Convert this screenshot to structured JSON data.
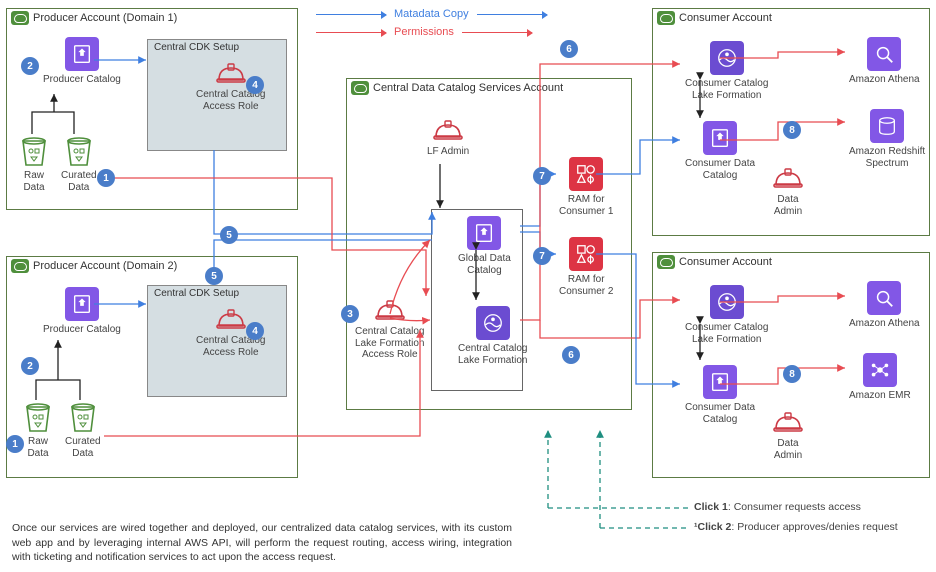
{
  "legend": {
    "metadata": "Matadata Copy",
    "permissions": "Permissions"
  },
  "producer1": {
    "title": "Producer Account (Domain 1)",
    "catalog": "Producer Catalog",
    "cdk_title": "Central CDK Setup",
    "access_role": "Central Catalog\nAccess Role",
    "raw": "Raw\nData",
    "curated": "Curated\nData"
  },
  "producer2": {
    "title": "Producer Account (Domain 2)",
    "catalog": "Producer Catalog",
    "cdk_title": "Central CDK Setup",
    "access_role": "Central Catalog\nAccess Role",
    "raw": "Raw\nData",
    "curated": "Curated\nData"
  },
  "central": {
    "title": "Central Data Catalog Services Account",
    "lf_admin": "LF Admin",
    "global_catalog": "Global Data\nCatalog",
    "central_lake": "Central Catalog\nLake Formation",
    "access_role": "Central Catalog\nLake Formation\nAccess Role",
    "ram1": "RAM for\nConsumer 1",
    "ram2": "RAM for\nConsumer 2"
  },
  "consumer1": {
    "title": "Consumer Account",
    "lake": "Consumer Catalog\nLake Formation",
    "catalog": "Consumer Data\nCatalog",
    "admin": "Data\nAdmin",
    "svc1": "Amazon Athena",
    "svc2": "Amazon Redshift\nSpectrum"
  },
  "consumer2": {
    "title": "Consumer Account",
    "lake": "Consumer Catalog\nLake Formation",
    "catalog": "Consumer Data\nCatalog",
    "admin": "Data\nAdmin",
    "svc1": "Amazon Athena",
    "svc2": "Amazon EMR"
  },
  "steps": {
    "1": "1",
    "2": "2",
    "3": "3",
    "4": "4",
    "5": "5",
    "6": "6",
    "7": "7",
    "8": "8"
  },
  "clicks": {
    "c1_bold": "Click 1",
    "c1_rest": ": Consumer requests access",
    "c2_bold": "¹Click 2",
    "c2_rest": ": Producer approves/denies request"
  },
  "footer": "Once our services are wired together and deployed, our centralized data catalog services, with its custom web app and by leveraging internal AWS API, will perform the request routing, access wiring, integration with ticketing and notification services to act upon the access request."
}
